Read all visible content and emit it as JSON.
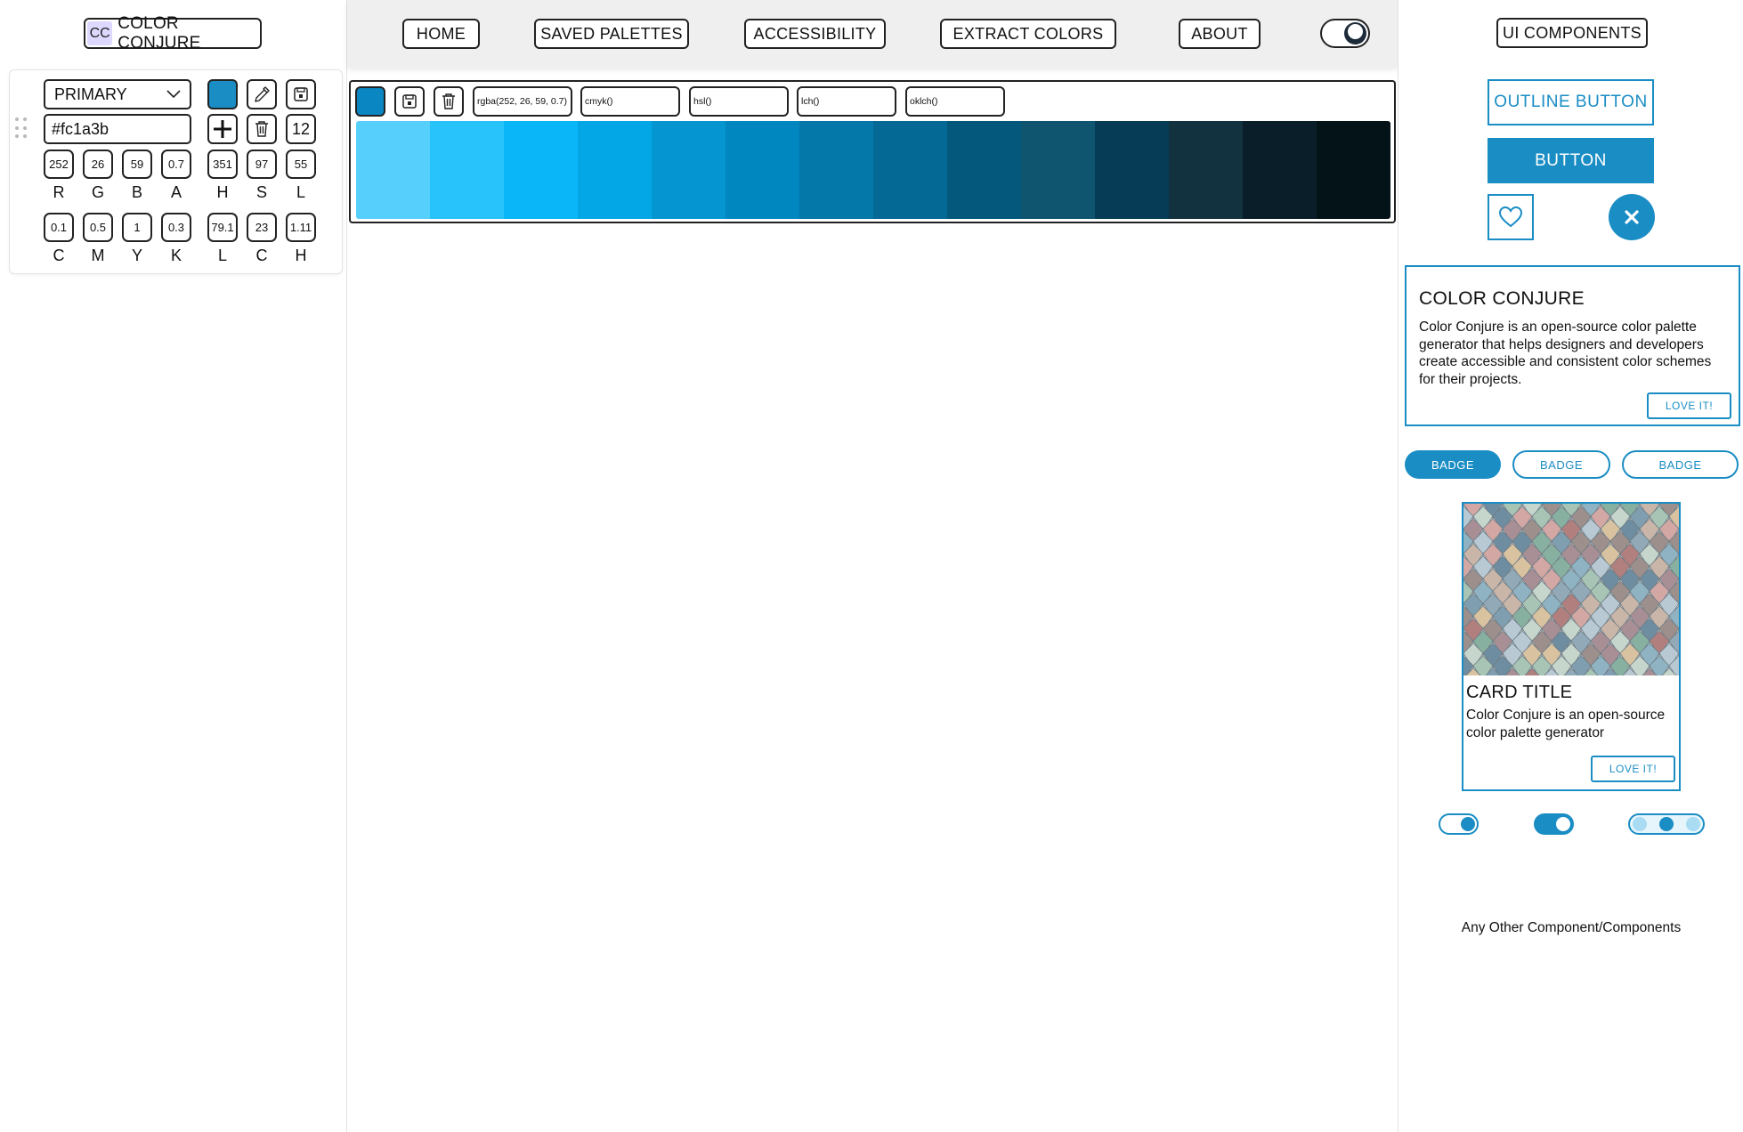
{
  "app": {
    "logo_mark": "CC",
    "logo_text": "COLOR CONJURE"
  },
  "nav": {
    "items": [
      "HOME",
      "SAVED PALETTES",
      "ACCESSIBILITY",
      "EXTRACT COLORS",
      "ABOUT"
    ],
    "theme_toggle": "dark-mode-toggle"
  },
  "picker": {
    "role_select": "PRIMARY",
    "hex_value": "#fc1a3b",
    "shade_count": "12",
    "rgba": {
      "values": [
        "252",
        "26",
        "59",
        "0.7"
      ],
      "labels": [
        "R",
        "G",
        "B",
        "A"
      ]
    },
    "hsl": {
      "values": [
        "351",
        "97",
        "55"
      ],
      "labels": [
        "H",
        "S",
        "L"
      ]
    },
    "cmyk": {
      "values": [
        "0.1",
        "0.5",
        "1",
        "0.3"
      ],
      "labels": [
        "C",
        "M",
        "Y",
        "K"
      ]
    },
    "lch": {
      "values": [
        "79.1",
        "23",
        "1.11"
      ],
      "labels": [
        "L",
        "C",
        "H"
      ]
    },
    "swatch_color": "#1a8dc4"
  },
  "palette": {
    "base_color": "#0a86c3",
    "formats": [
      "rgba(252, 26, 59, 0.7)",
      "cmyk()",
      "hsl()",
      "lch()",
      "oklch()"
    ],
    "shades": [
      "#56cffd",
      "#29c3fb",
      "#0bb6f8",
      "#03a7e6",
      "#0595d1",
      "#0187c0",
      "#0479a9",
      "#046994",
      "#04587c",
      "#0f5570",
      "#073c56",
      "#12323f",
      "#0a1e29",
      "#041318"
    ]
  },
  "ui": {
    "title": "UI COMPONENTS",
    "outline_button": "OUTLINE BUTTON",
    "solid_button": "BUTTON",
    "accent": "#1a8dc4",
    "info_card": {
      "title": "COLOR CONJURE",
      "body": "Color Conjure is an open-source color palette generator that helps designers and developers create accessible and consistent color schemes for their projects.",
      "action": "LOVE IT!"
    },
    "badges": [
      "BADGE",
      "BADGE",
      "BADGE"
    ],
    "image_card": {
      "title": "CARD TITLE",
      "body": "Color Conjure is an open-source color palette generator",
      "action": "LOVE IT!"
    },
    "other": "Any Other Component/Components"
  }
}
